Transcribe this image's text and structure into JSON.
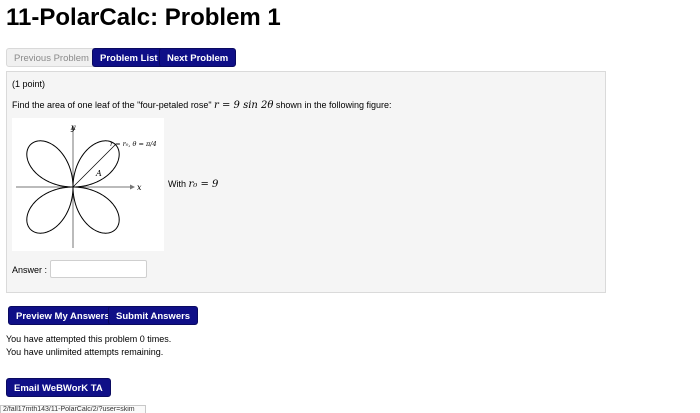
{
  "page": {
    "title": "11-PolarCalc: Problem 1"
  },
  "nav": {
    "previous_label": "Previous Problem",
    "list_label": "Problem List",
    "next_label": "Next Problem"
  },
  "problem": {
    "points": "(1 point)",
    "statement_prefix": "Find the area of one leaf of the \"four-petaled rose\" ",
    "statement_math": "r = 9 sin 2θ",
    "statement_suffix": " shown in the following figure:",
    "with_prefix": "With ",
    "with_math": "r₀ = 9",
    "figure": {
      "y_axis_label": "y",
      "x_axis_label": "x",
      "region_label": "A",
      "curve_label": "r = r₀,  θ = π/4"
    },
    "answer_label": "Answer :",
    "answer_value": ""
  },
  "actions": {
    "preview_label": "Preview My Answers",
    "submit_label": "Submit Answers"
  },
  "attempts": {
    "line1": "You have attempted this problem 0 times.",
    "line2": "You have unlimited attempts remaining."
  },
  "email": {
    "label": "Email WeBWorK TA"
  },
  "url": {
    "text": "2/fall17mth143/11-PolarCalc/2/?user=skim"
  },
  "colors": {
    "primary_button": "#0f0f87",
    "problem_box_bg": "#f5f5f5"
  }
}
